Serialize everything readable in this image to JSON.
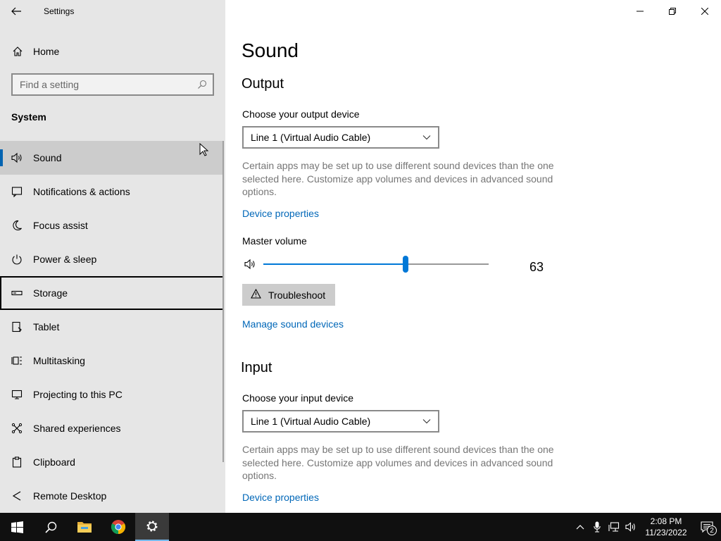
{
  "window": {
    "title": "Settings"
  },
  "sidebar": {
    "home_label": "Home",
    "search_placeholder": "Find a setting",
    "section_title": "System",
    "items": [
      {
        "label": "Sound",
        "icon": "speaker-icon",
        "selected": true
      },
      {
        "label": "Notifications & actions",
        "icon": "notifications-icon"
      },
      {
        "label": "Focus assist",
        "icon": "moon-icon"
      },
      {
        "label": "Power & sleep",
        "icon": "power-icon"
      },
      {
        "label": "Storage",
        "icon": "storage-icon",
        "focused": true
      },
      {
        "label": "Tablet",
        "icon": "tablet-icon"
      },
      {
        "label": "Multitasking",
        "icon": "multitasking-icon"
      },
      {
        "label": "Projecting to this PC",
        "icon": "projecting-icon"
      },
      {
        "label": "Shared experiences",
        "icon": "shared-icon"
      },
      {
        "label": "Clipboard",
        "icon": "clipboard-icon"
      },
      {
        "label": "Remote Desktop",
        "icon": "remote-desktop-icon"
      }
    ]
  },
  "main": {
    "page_title": "Sound",
    "output": {
      "heading": "Output",
      "device_label": "Choose your output device",
      "device_value": "Line 1 (Virtual Audio Cable)",
      "description": "Certain apps may be set up to use different sound devices than the one selected here. Customize app volumes and devices in advanced sound options.",
      "device_properties_link": "Device properties",
      "master_volume_label": "Master volume",
      "volume_value": "63",
      "volume_level": 0.63,
      "troubleshoot_label": "Troubleshoot",
      "manage_link": "Manage sound devices"
    },
    "input": {
      "heading": "Input",
      "device_label": "Choose your input device",
      "device_value": "Line 1 (Virtual Audio Cable)",
      "description": "Certain apps may be set up to use different sound devices than the one selected here. Customize app volumes and devices in advanced sound options.",
      "device_properties_link": "Device properties"
    }
  },
  "taskbar": {
    "time": "2:08 PM",
    "date": "11/23/2022",
    "notification_count": "2"
  },
  "colors": {
    "accent": "#0078d7",
    "link": "#0067b8",
    "sidebar_bg": "#e6e6e6",
    "taskbar_bg": "#101010"
  }
}
